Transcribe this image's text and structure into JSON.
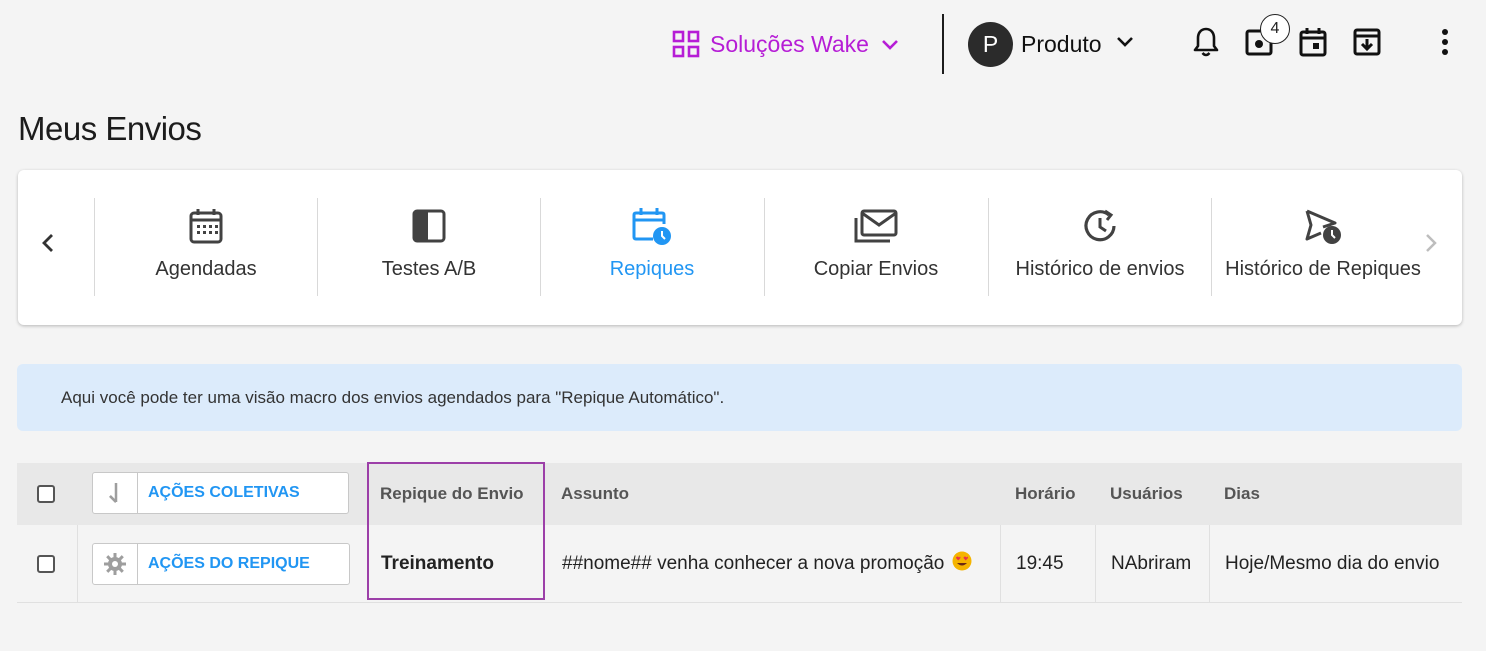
{
  "topbar": {
    "solucoes_label": "Soluções Wake",
    "avatar_initial": "P",
    "produto_label": "Produto",
    "badge_count": "4"
  },
  "page_title": "Meus Envios",
  "nav": {
    "items": [
      {
        "label": "Agendadas",
        "icon": "calendar-grid-icon"
      },
      {
        "label": "Testes A/B",
        "icon": "half-square-icon"
      },
      {
        "label": "Repiques",
        "icon": "calendar-clock-icon",
        "active": true
      },
      {
        "label": "Copiar Envios",
        "icon": "mail-stack-icon"
      },
      {
        "label": "Histórico de envios",
        "icon": "history-icon"
      },
      {
        "label": "Histórico de Repiques",
        "icon": "send-clock-icon"
      }
    ]
  },
  "info_text": "Aqui você pode ter uma visão macro dos envios agendados para \"Repique Automático\".",
  "table": {
    "bulk_actions_label": "AÇÕES COLETIVAS",
    "headers": {
      "repique": "Repique do Envio",
      "assunto": "Assunto",
      "horario": "Horário",
      "usuarios": "Usuários",
      "dias": "Dias"
    },
    "rows": [
      {
        "actions_label": "AÇÕES DO REPIQUE",
        "repique": "Treinamento",
        "assunto": "##nome## venha conhecer a nova promoção",
        "horario": "19:45",
        "usuarios": "NAbriram",
        "dias": "Hoje/Mesmo dia do envio"
      }
    ]
  },
  "colors": {
    "accent_blue": "#2196f3",
    "brand_purple": "#b61dd6",
    "highlight_purple": "#9c3fa8",
    "info_bg": "#dcebfb"
  }
}
